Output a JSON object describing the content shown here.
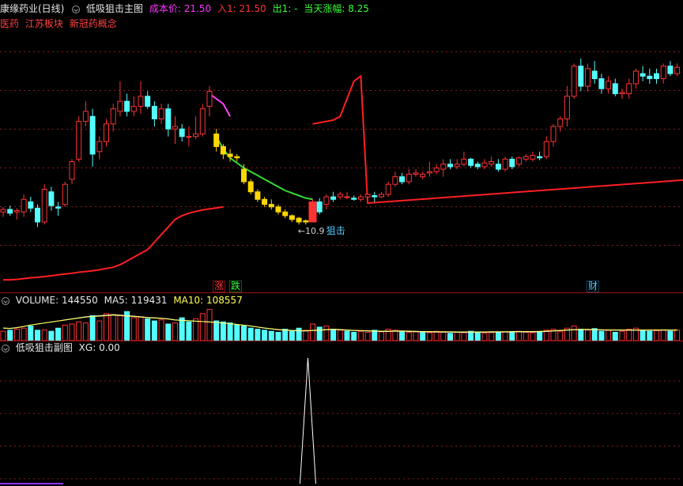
{
  "main_panel": {
    "stock_name": "康缘药业(日线)",
    "indicator_name": "低吸狙击主图",
    "cost_label": "成本价:",
    "cost_value": "21.50",
    "entry_label": "入1:",
    "entry_value": "21.50",
    "exit_label": "出1:",
    "exit_value": "-",
    "gain_label": "当天涨幅:",
    "gain_value": "8.25",
    "concepts": [
      "医药",
      "江苏板块",
      "新冠药概念"
    ],
    "low_price_label": "10.9",
    "signal_label": "狙击",
    "marker_rise": "涨",
    "marker_fall": "跌",
    "marker_finance": "财"
  },
  "volume_panel": {
    "volume_label": "VOLUME:",
    "volume_value": "144550",
    "ma5_label": "MA5:",
    "ma5_value": "119431",
    "ma10_label": "MA10:",
    "ma10_value": "108557"
  },
  "sub_panel": {
    "title": "低吸狙击副图",
    "xg_label": "XG:",
    "xg_value": "0.00"
  },
  "colors": {
    "up": "#ff3333",
    "down": "#54ffff",
    "highlight": "#ffd700",
    "ma_line": "#ff2020",
    "green_line": "#33dd33",
    "pink_line": "#ff44ff",
    "magenta_text": "#ff33ff",
    "yellow_text": "#ffff55",
    "green_text": "#33ff33"
  },
  "chart_data": {
    "type": "candlestick",
    "candles": [
      [
        17.2,
        17.4,
        17.0,
        17.3
      ],
      [
        17.3,
        17.45,
        17.05,
        17.15
      ],
      [
        17.2,
        17.35,
        16.9,
        17.25
      ],
      [
        17.2,
        17.9,
        17.0,
        17.7
      ],
      [
        17.6,
        17.8,
        17.2,
        17.35
      ],
      [
        17.35,
        17.5,
        16.6,
        16.8
      ],
      [
        16.8,
        18.3,
        16.7,
        18.1
      ],
      [
        18.0,
        18.2,
        17.25,
        17.45
      ],
      [
        17.4,
        17.6,
        17.05,
        17.35
      ],
      [
        17.5,
        18.4,
        17.4,
        18.3
      ],
      [
        18.5,
        19.3,
        18.3,
        19.2
      ],
      [
        19.3,
        21.0,
        19.2,
        20.8
      ],
      [
        20.8,
        21.6,
        20.6,
        21.2
      ],
      [
        21.0,
        21.3,
        19.0,
        19.5
      ],
      [
        19.6,
        20.2,
        19.3,
        20.0
      ],
      [
        20.0,
        20.9,
        19.8,
        20.7
      ],
      [
        20.7,
        21.5,
        20.4,
        21.3
      ],
      [
        21.2,
        22.4,
        21.0,
        21.6
      ],
      [
        21.6,
        21.9,
        21.0,
        21.2
      ],
      [
        21.2,
        21.8,
        21.0,
        21.4
      ],
      [
        21.4,
        22.4,
        21.1,
        21.8
      ],
      [
        21.8,
        22.0,
        21.3,
        21.4
      ],
      [
        21.4,
        21.6,
        20.6,
        20.9
      ],
      [
        20.9,
        21.5,
        20.7,
        21.3
      ],
      [
        21.3,
        21.5,
        20.2,
        20.5
      ],
      [
        20.5,
        21.0,
        19.9,
        20.6
      ],
      [
        20.5,
        20.7,
        20.0,
        20.2
      ],
      [
        20.2,
        20.6,
        19.8,
        20.2
      ],
      [
        20.2,
        21.0,
        20.1,
        20.3
      ],
      [
        20.3,
        21.5,
        20.2,
        21.3
      ],
      [
        21.4,
        22.2,
        21.0,
        22.0
      ],
      [
        20.3,
        20.5,
        19.6,
        19.8
      ],
      [
        19.8,
        19.9,
        19.3,
        19.5
      ],
      [
        19.5,
        19.7,
        19.2,
        19.4
      ],
      [
        19.4,
        19.5,
        19.2,
        19.35
      ],
      [
        18.9,
        19.1,
        18.3,
        18.4
      ],
      [
        18.4,
        18.5,
        17.9,
        18.0
      ],
      [
        18.0,
        18.1,
        17.6,
        17.7
      ],
      [
        17.7,
        17.8,
        17.4,
        17.5
      ],
      [
        17.5,
        17.7,
        17.3,
        17.4
      ],
      [
        17.4,
        17.5,
        17.1,
        17.2
      ],
      [
        17.2,
        17.3,
        16.95,
        17.05
      ],
      [
        17.05,
        17.1,
        16.8,
        16.9
      ],
      [
        16.95,
        17.0,
        16.7,
        16.8
      ],
      [
        16.8,
        16.9,
        16.7,
        16.85
      ],
      [
        16.8,
        17.7,
        16.8,
        17.6
      ],
      [
        17.6,
        17.75,
        17.1,
        17.2
      ],
      [
        17.5,
        17.9,
        17.3,
        17.8
      ],
      [
        17.8,
        18.0,
        17.6,
        17.7
      ],
      [
        17.8,
        18.0,
        17.7,
        17.9
      ],
      [
        17.8,
        18.0,
        17.7,
        17.8
      ],
      [
        17.75,
        17.85,
        17.65,
        17.7
      ],
      [
        17.7,
        17.9,
        17.6,
        17.8
      ],
      [
        17.8,
        17.95,
        17.7,
        17.9
      ],
      [
        17.85,
        18.0,
        17.6,
        17.8
      ],
      [
        17.8,
        18.0,
        17.75,
        17.9
      ],
      [
        17.9,
        18.4,
        17.8,
        18.3
      ],
      [
        18.3,
        18.8,
        18.2,
        18.6
      ],
      [
        18.6,
        18.75,
        18.3,
        18.4
      ],
      [
        18.4,
        18.9,
        18.3,
        18.7
      ],
      [
        18.7,
        18.9,
        18.6,
        18.75
      ],
      [
        18.6,
        18.8,
        18.5,
        18.7
      ],
      [
        18.75,
        19.2,
        18.6,
        18.8
      ],
      [
        18.8,
        19.1,
        18.7,
        18.95
      ],
      [
        18.9,
        19.3,
        18.6,
        19.1
      ],
      [
        19.1,
        19.3,
        18.9,
        19.0
      ],
      [
        19.0,
        19.3,
        18.9,
        19.1
      ],
      [
        19.1,
        19.6,
        19.0,
        19.3
      ],
      [
        19.3,
        19.35,
        18.95,
        19.05
      ],
      [
        19.1,
        19.2,
        18.9,
        19.0
      ],
      [
        19.0,
        19.3,
        18.9,
        19.15
      ],
      [
        19.1,
        19.4,
        19.0,
        19.2
      ],
      [
        19.1,
        19.3,
        18.8,
        18.9
      ],
      [
        18.9,
        19.4,
        18.8,
        19.3
      ],
      [
        19.3,
        19.4,
        18.9,
        19.0
      ],
      [
        19.1,
        19.4,
        19.0,
        19.35
      ],
      [
        19.3,
        19.5,
        19.2,
        19.4
      ],
      [
        19.3,
        19.6,
        19.2,
        19.45
      ],
      [
        19.4,
        19.6,
        19.25,
        19.35
      ],
      [
        19.4,
        20.2,
        19.3,
        20.0
      ],
      [
        20.0,
        20.7,
        19.8,
        20.6
      ],
      [
        20.6,
        21.0,
        20.4,
        20.9
      ],
      [
        20.9,
        22.2,
        20.6,
        21.8
      ],
      [
        21.8,
        23.1,
        21.7,
        23.0
      ],
      [
        23.0,
        23.3,
        22.0,
        22.2
      ],
      [
        22.2,
        23.1,
        22.0,
        22.9
      ],
      [
        22.8,
        23.2,
        22.3,
        22.5
      ],
      [
        22.5,
        22.7,
        21.9,
        22.1
      ],
      [
        22.1,
        22.6,
        21.9,
        22.4
      ],
      [
        22.3,
        22.5,
        21.8,
        21.9
      ],
      [
        21.9,
        22.1,
        21.7,
        21.95
      ],
      [
        21.9,
        22.5,
        21.7,
        22.3
      ],
      [
        22.3,
        22.9,
        22.1,
        22.8
      ],
      [
        22.7,
        23.0,
        22.4,
        22.6
      ],
      [
        22.6,
        22.9,
        22.3,
        22.5
      ],
      [
        22.7,
        22.9,
        22.3,
        22.5
      ],
      [
        22.5,
        23.1,
        22.3,
        23.0
      ],
      [
        23.0,
        23.2,
        22.6,
        22.7
      ],
      [
        22.7,
        23.1,
        22.6,
        22.95
      ]
    ],
    "highlight_range": [
      31,
      44
    ],
    "signal_index": 45,
    "ma_long": [
      14.5,
      14.5,
      14.52,
      14.55,
      14.58,
      14.6,
      14.63,
      14.66,
      14.7,
      14.73,
      14.76,
      14.8,
      14.83,
      14.86,
      14.9,
      14.95,
      15.0,
      15.1,
      15.25,
      15.4,
      15.55,
      15.7,
      16.0,
      16.3,
      16.6,
      16.9,
      17.05,
      17.15,
      17.22,
      17.28,
      17.32,
      17.36,
      17.4,
      17.45,
      17.5,
      17.65,
      17.95,
      18.45,
      19.05,
      19.55,
      20.0,
      20.1,
      20.15,
      20.2,
      20.25,
      20.3,
      20.35,
      20.4,
      20.45,
      20.6,
      21.3,
      22.0,
      22.2,
      17.15,
      17.17,
      17.19,
      17.21,
      17.23,
      17.25,
      17.27,
      17.29,
      17.31,
      17.33,
      17.35,
      17.37,
      17.39,
      17.41,
      17.43,
      17.45,
      17.47,
      17.49,
      17.51,
      17.53,
      17.55,
      17.57,
      17.59,
      17.61,
      17.63,
      17.65,
      17.67,
      17.69,
      17.71,
      17.73,
      17.75,
      17.77,
      17.79,
      17.81,
      17.83,
      17.85,
      17.87,
      17.89,
      17.91,
      17.93,
      17.95,
      17.97,
      17.99,
      18.01,
      18.03,
      18.05,
      18.07,
      18.09,
      18.11
    ],
    "green_line": [
      20.2,
      19.7,
      19.35,
      19.15,
      18.95,
      18.8,
      18.65,
      18.5,
      18.35,
      18.2,
      18.05,
      17.95,
      17.85,
      17.75,
      17.7
    ],
    "low_price": 16.7,
    "price_range": [
      14.0,
      25.0
    ],
    "volume": [
      45,
      50,
      55,
      60,
      70,
      50,
      52,
      45,
      60,
      75,
      80,
      90,
      85,
      120,
      95,
      130,
      125,
      120,
      140,
      110,
      115,
      105,
      95,
      100,
      80,
      85,
      110,
      90,
      105,
      130,
      150,
      95,
      90,
      85,
      75,
      70,
      60,
      55,
      50,
      45,
      40,
      55,
      45,
      60,
      50,
      80,
      65,
      70,
      55,
      50,
      45,
      40,
      45,
      40,
      50,
      42,
      55,
      50,
      45,
      40,
      42,
      40,
      38,
      45,
      40,
      35,
      42,
      38,
      45,
      40,
      35,
      38,
      40,
      42,
      38,
      45,
      40,
      38,
      42,
      50,
      55,
      45,
      60,
      70,
      55,
      50,
      58,
      45,
      50,
      40,
      45,
      55,
      60,
      50,
      45,
      48,
      52,
      45,
      50
    ],
    "volume_up": [
      true,
      false,
      true,
      true,
      false,
      false,
      true,
      false,
      false,
      true,
      true,
      true,
      true,
      false,
      true,
      true,
      true,
      true,
      false,
      true,
      true,
      false,
      false,
      true,
      false,
      true,
      false,
      false,
      true,
      true,
      true,
      false,
      false,
      false,
      false,
      false,
      false,
      false,
      false,
      false,
      false,
      false,
      false,
      false,
      true,
      true,
      false,
      true,
      false,
      true,
      false,
      false,
      true,
      true,
      false,
      true,
      true,
      true,
      false,
      true,
      true,
      false,
      true,
      true,
      true,
      false,
      true,
      true,
      false,
      false,
      true,
      true,
      false,
      true,
      false,
      true,
      true,
      true,
      false,
      true,
      true,
      true,
      true,
      true,
      false,
      true,
      false,
      false,
      true,
      false,
      true,
      true,
      true,
      false,
      false,
      true,
      true,
      false,
      true
    ],
    "volume_max": 160,
    "ma5_line": [
      60,
      58,
      62,
      68,
      75,
      80,
      85,
      90,
      95,
      100,
      105,
      110,
      115,
      118,
      120,
      122,
      125,
      123,
      120,
      118,
      115,
      112,
      110,
      108,
      105,
      100,
      98,
      96,
      94,
      92,
      90,
      88,
      85,
      82,
      78,
      74,
      70,
      65,
      60,
      56,
      52,
      50,
      48,
      47,
      46,
      48,
      50,
      52,
      54,
      52,
      50,
      48,
      47,
      46,
      45,
      44,
      44,
      45,
      45,
      44,
      43,
      42,
      42,
      41,
      41,
      41,
      40,
      40,
      40,
      40,
      40,
      41,
      41,
      41,
      42,
      42,
      42,
      42,
      43,
      44,
      46,
      48,
      50,
      52,
      53,
      53,
      52,
      51,
      50,
      50,
      50,
      50,
      50,
      50,
      50,
      50,
      50,
      50,
      50
    ],
    "xg_signal_index": 45
  }
}
